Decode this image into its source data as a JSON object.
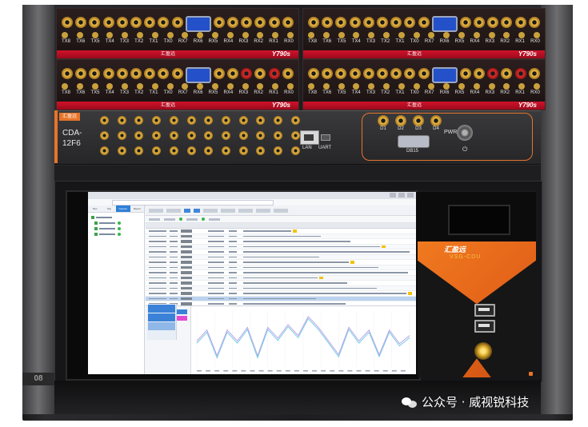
{
  "modules": [
    {
      "brand": "Y790s",
      "logo": "汇盈远",
      "labels": [
        "TX8",
        "TX6",
        "TX5",
        "TX4",
        "TX3",
        "TX2",
        "TX1",
        "TX0",
        "RX7",
        "RX6",
        "RX5",
        "RX4",
        "RX3",
        "RX2",
        "RX1",
        "RX0"
      ]
    },
    {
      "brand": "Y790s",
      "logo": "汇盈远",
      "labels": [
        "TX8",
        "TX6",
        "TX5",
        "TX4",
        "TX3",
        "TX2",
        "TX1",
        "TX0",
        "RX7",
        "RX6",
        "RX5",
        "RX4",
        "RX3",
        "RX2",
        "RX1",
        "RX0"
      ]
    },
    {
      "brand": "Y790s",
      "logo": "汇盈远",
      "labels": [
        "TX8",
        "TX6",
        "TX5",
        "TX4",
        "TX3",
        "TX2",
        "TX1",
        "TX0",
        "RX7",
        "RX6",
        "RX5",
        "RX4",
        "RX3",
        "RX2",
        "RX1",
        "RX0"
      ]
    },
    {
      "brand": "Y790s",
      "logo": "汇盈远",
      "labels": [
        "TX8",
        "TX6",
        "TX5",
        "TX4",
        "TX3",
        "TX2",
        "TX1",
        "TX0",
        "RX7",
        "RX6",
        "RX5",
        "RX4",
        "RX3",
        "RX2",
        "RX1",
        "RX0"
      ]
    }
  ],
  "main_unit": {
    "badge": "汇盈远",
    "name": "CDA-12F6",
    "lan_label": "LAN",
    "uart_label": "UART",
    "db15_label": "DB15",
    "pwr_label": "PWR",
    "port_labels": [
      "D1",
      "D2",
      "D3",
      "D4"
    ],
    "accent": "#e6742a"
  },
  "rail": {
    "label": "08"
  },
  "pc_case": {
    "logo": "汇盈远",
    "model": "VSG-CDU",
    "accent": "#f07a1f"
  },
  "watermark": {
    "text": "公众号 · 威视锐科技"
  },
  "screen": {
    "left_tabs": [
      "Dev",
      "Cfg",
      "Capture",
      "Report"
    ],
    "active_tab": 2,
    "chart_series_colors": [
      "#b9a4e6",
      "#7ac9e8"
    ]
  }
}
